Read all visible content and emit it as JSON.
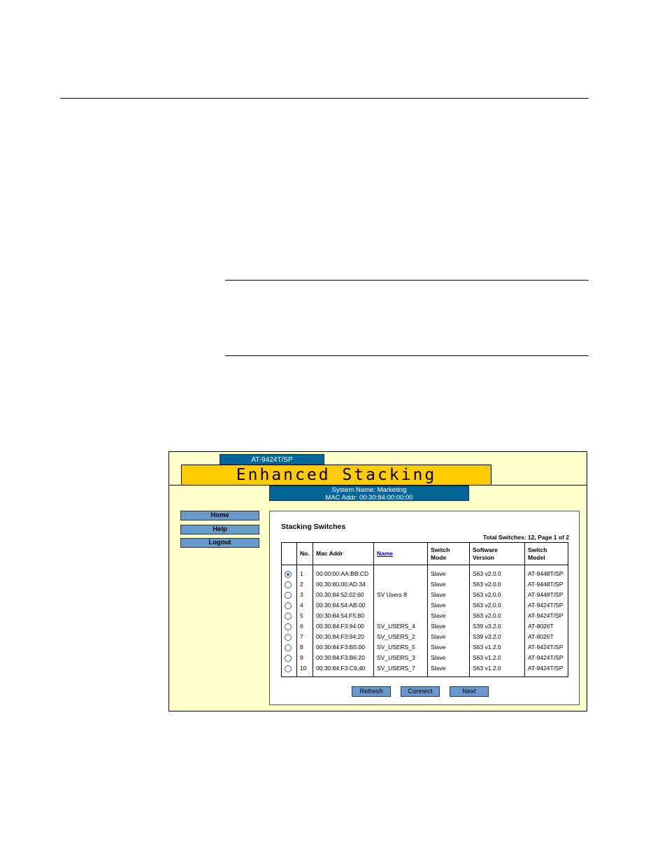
{
  "app": {
    "model_tab": "AT-9424T/SP",
    "title": "Enhanced Stacking",
    "system_name": "System Name: Marketing",
    "mac_addr": "MAC Addr: 00:30:84:00:00:00"
  },
  "nav": {
    "home": "Home",
    "help": "Help",
    "logout": "Logout"
  },
  "panel": {
    "title": "Stacking Switches",
    "total": "Total Switches: 12, Page 1 of 2"
  },
  "table": {
    "headers": {
      "no": "No.",
      "mac": "Mac Addr",
      "name": "Name",
      "mode_1": "Switch",
      "mode_2": "Mode",
      "version_1": "Software",
      "version_2": "Version",
      "model_1": "Switch",
      "model_2": "Model"
    },
    "rows": [
      {
        "no": "1",
        "mac": "00:00:00:AA:BB:CD",
        "name": "",
        "mode": "Slave",
        "version": "S63 v2.0.0",
        "model": "AT-9448T/SP",
        "selected": true
      },
      {
        "no": "2",
        "mac": "00:30:80:00:AD:34",
        "name": "",
        "mode": "Slave",
        "version": "S63 v2.0.0",
        "model": "AT-9448T/SP",
        "selected": false
      },
      {
        "no": "3",
        "mac": "00:30:84:52:02:60",
        "name": "SV Users 8",
        "mode": "Slave",
        "version": "S63 v2.0.0",
        "model": "AT-9448T/SP",
        "selected": false
      },
      {
        "no": "4",
        "mac": "00:30:84:54:AB:00",
        "name": "",
        "mode": "Slave",
        "version": "S63 v2.0.0",
        "model": "AT-9424T/SP",
        "selected": false
      },
      {
        "no": "5",
        "mac": "00:30:84:54:F5:80",
        "name": "",
        "mode": "Slave",
        "version": "S63 v2.0.0",
        "model": "AT-9424T/SP",
        "selected": false
      },
      {
        "no": "6",
        "mac": "00:30:84:F3:94:00",
        "name": "SV_USERS_4",
        "mode": "Slave",
        "version": "S39 v3.2.0",
        "model": "AT-8026T",
        "selected": false
      },
      {
        "no": "7",
        "mac": "00:30:84:F3:94:20",
        "name": "SV_USERS_2",
        "mode": "Slave",
        "version": "S39 v3.2.0",
        "model": "AT-8026T",
        "selected": false
      },
      {
        "no": "8",
        "mac": "00:30:84:F3:B5:00",
        "name": "SV_USERS_5",
        "mode": "Slave",
        "version": "S63 v1.2.0",
        "model": "AT-9424T/SP",
        "selected": false
      },
      {
        "no": "9",
        "mac": "00:30:84:F3:B6:20",
        "name": "SV_USERS_3",
        "mode": "Slave",
        "version": "S63 v1.2.0",
        "model": "AT-9424T/SP",
        "selected": false
      },
      {
        "no": "10",
        "mac": "00:30:84:F3:C9:40",
        "name": "SV_USERS_7",
        "mode": "Slave",
        "version": "S63 v1.2.0",
        "model": "AT-9424T/SP",
        "selected": false
      }
    ]
  },
  "actions": {
    "refresh": "Refresh",
    "connect": "Connect",
    "next": "Next"
  },
  "colors": {
    "page_bg": "#ffffcc",
    "title_bg": "#ffcc00",
    "header_bg": "#006699",
    "button_bg": "#6699cc",
    "link": "#0000cc"
  }
}
